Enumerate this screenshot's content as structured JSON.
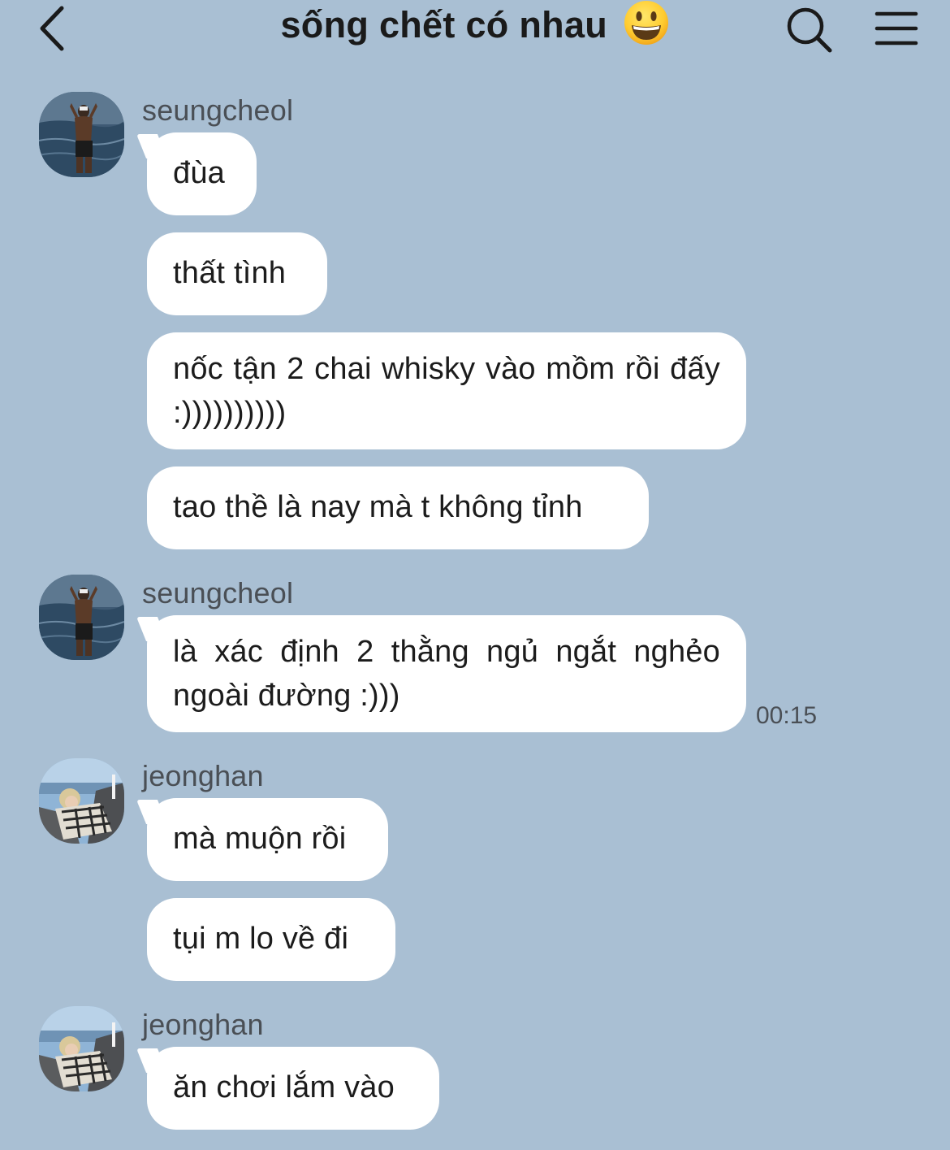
{
  "header": {
    "title": "sống chết có nhau",
    "title_emoji": "grinning-face-emoji",
    "back_icon": "chevron-left-icon",
    "search_icon": "search-icon",
    "menu_icon": "menu-icon"
  },
  "colors": {
    "background": "#a9bfd3",
    "bubble": "#ffffff",
    "text": "#1c1c1c",
    "meta_text": "#4a4f55"
  },
  "messages": [
    {
      "sender": "seungcheol",
      "bubbles": [
        "đùa",
        "thất tình",
        "nốc tận 2 chai whisky vào mồm rồi đấy :))))))))))",
        "tao thề là nay mà t không tỉnh"
      ]
    },
    {
      "sender": "seungcheol",
      "bubbles": [
        "là xác định 2 thằng ngủ ngắt nghẻo ngoài đường :)))"
      ],
      "time": "00:15"
    },
    {
      "sender": "jeonghan",
      "bubbles": [
        "mà muộn rồi",
        "tụi m lo về đi"
      ]
    },
    {
      "sender": "jeonghan",
      "bubbles": [
        "ăn chơi lắm vào"
      ]
    }
  ]
}
